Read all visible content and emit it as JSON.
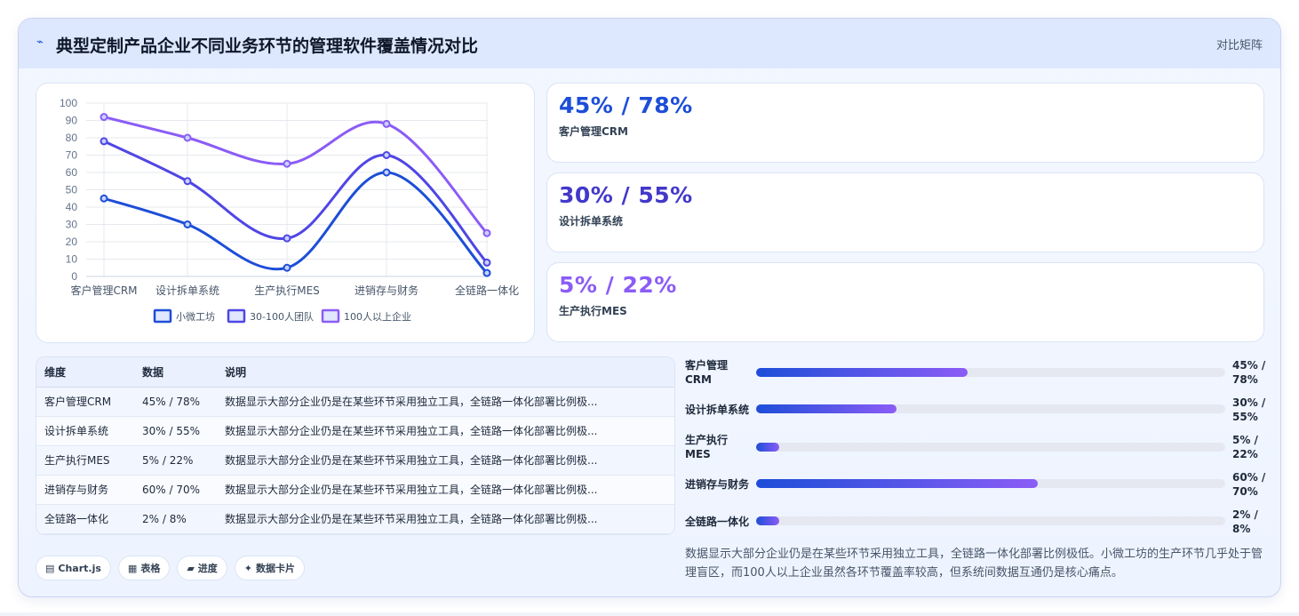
{
  "header": {
    "logo_glyph": "⌁",
    "title": "典型定制产品企业不同业务环节的管理软件覆盖情况对比",
    "mode": "对比矩阵"
  },
  "stats": [
    {
      "value": "45% / 78%",
      "label": "客户管理CRM",
      "color": "#1d4ed8"
    },
    {
      "value": "30% / 55%",
      "label": "设计拆单系统",
      "color": "#4338ca"
    },
    {
      "value": "5% / 22%",
      "label": "生产执行MES",
      "color": "#8b5cf6"
    }
  ],
  "table": {
    "headers": [
      "维度",
      "数据",
      "说明"
    ],
    "rows": [
      {
        "dim": "客户管理CRM",
        "data": "45% / 78%",
        "desc": "数据显示大部分企业仍是在某些环节采用独立工具，全链路一体化部署比例极..."
      },
      {
        "dim": "设计拆单系统",
        "data": "30% / 55%",
        "desc": "数据显示大部分企业仍是在某些环节采用独立工具，全链路一体化部署比例极..."
      },
      {
        "dim": "生产执行MES",
        "data": "5% / 22%",
        "desc": "数据显示大部分企业仍是在某些环节采用独立工具，全链路一体化部署比例极..."
      },
      {
        "dim": "进销存与财务",
        "data": "60% / 70%",
        "desc": "数据显示大部分企业仍是在某些环节采用独立工具，全链路一体化部署比例极..."
      },
      {
        "dim": "全链路一体化",
        "data": "2% / 8%",
        "desc": "数据显示大部分企业仍是在某些环节采用独立工具，全链路一体化部署比例极..."
      }
    ]
  },
  "bars": [
    {
      "label": "客户管理CRM",
      "value": "45% / 78%",
      "fill": 0.45
    },
    {
      "label": "设计拆单系统",
      "value": "30% / 55%",
      "fill": 0.3
    },
    {
      "label": "生产执行MES",
      "value": "5% / 22%",
      "fill": 0.05
    },
    {
      "label": "进销存与财务",
      "value": "60% / 70%",
      "fill": 0.6
    },
    {
      "label": "全链路一体化",
      "value": "2% / 8%",
      "fill": 0.05
    }
  ],
  "summary": "数据显示大部分企业仍是在某些环节采用独立工具，全链路一体化部署比例极低。小微工坊的生产环节几乎处于管理盲区，而100人以上企业虽然各环节覆盖率较高，但系统间数据互通仍是核心痛点。",
  "chips": [
    {
      "icon": "▤",
      "label": "Chart.js"
    },
    {
      "icon": "▦",
      "label": "表格"
    },
    {
      "icon": "▰",
      "label": "进度"
    },
    {
      "icon": "✦",
      "label": "数据卡片"
    }
  ],
  "chart_data": {
    "type": "line",
    "categories": [
      "客户管理CRM",
      "设计拆单系统",
      "生产执行MES",
      "进销存与财务",
      "全链路一体化"
    ],
    "series": [
      {
        "name": "小微工坊",
        "values": [
          45,
          30,
          5,
          60,
          2
        ],
        "color": "#1d4ed8"
      },
      {
        "name": "30-100人团队",
        "values": [
          78,
          55,
          22,
          70,
          8
        ],
        "color": "#4f46e5"
      },
      {
        "name": "100人以上企业",
        "values": [
          92,
          80,
          65,
          88,
          25
        ],
        "color": "#8b5cf6"
      }
    ],
    "ylim": [
      0,
      100
    ],
    "yticks": [
      "0",
      "10",
      "20",
      "30",
      "40",
      "50",
      "60",
      "70",
      "80",
      "90",
      "100"
    ],
    "grid": true,
    "legend": "bottom"
  }
}
